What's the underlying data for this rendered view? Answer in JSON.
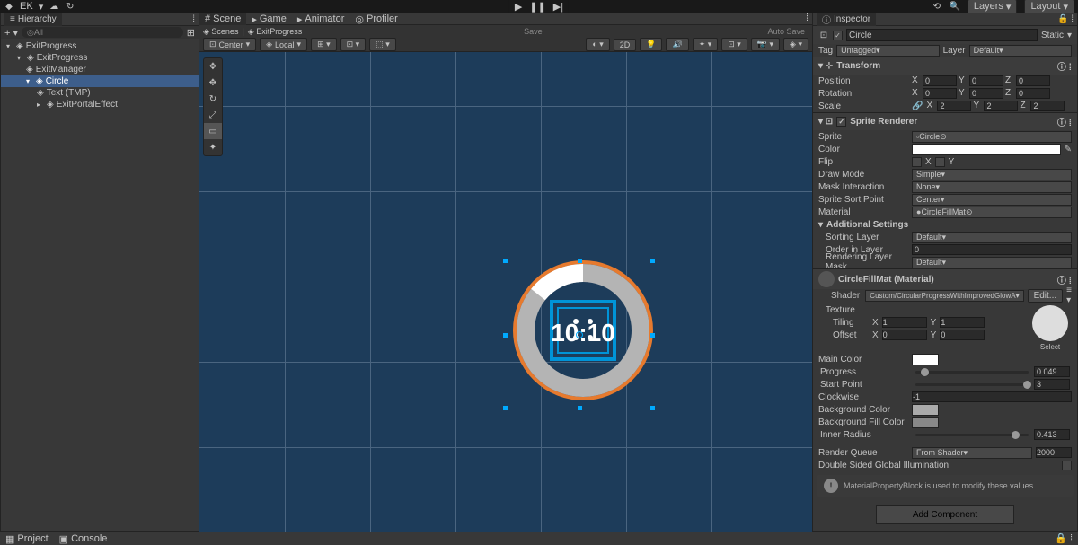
{
  "topbar": {
    "user": "EK",
    "layers_label": "Layers",
    "layout_label": "Layout"
  },
  "playback": {
    "play": "▶",
    "pause": "❚❚",
    "step": "▶|"
  },
  "hierarchy": {
    "title": "Hierarchy",
    "search_placeholder": "All",
    "scene_name": "ExitProgress",
    "nodes": {
      "root": "ExitProgress",
      "n1": "ExitManager",
      "n2": "Circle",
      "n3": "Text (TMP)",
      "n4": "ExitPortalEffect"
    }
  },
  "tabs": {
    "scene": "Scene",
    "game": "Game",
    "animator": "Animator",
    "profiler": "Profiler"
  },
  "scene_toolbar": {
    "scenes_label": "Scenes",
    "current_scene": "ExitProgress",
    "save": "Save",
    "autosave": "Auto Save",
    "center": "Center",
    "local": "Local",
    "mode2d": "2D"
  },
  "inspector": {
    "title": "Inspector",
    "object_name": "Circle",
    "static_label": "Static",
    "tag_label": "Tag",
    "tag_value": "Untagged",
    "layer_label": "Layer",
    "layer_value": "Default",
    "transform": {
      "title": "Transform",
      "position": {
        "label": "Position",
        "x": "0",
        "y": "0",
        "z": "0"
      },
      "rotation": {
        "label": "Rotation",
        "x": "0",
        "y": "0",
        "z": "0"
      },
      "scale": {
        "label": "Scale",
        "x": "2",
        "y": "2",
        "z": "2"
      }
    },
    "sprite_renderer": {
      "title": "Sprite Renderer",
      "sprite_label": "Sprite",
      "sprite_value": "Circle",
      "color_label": "Color",
      "flip_label": "Flip",
      "flip_x": "X",
      "flip_y": "Y",
      "draw_mode_label": "Draw Mode",
      "draw_mode_value": "Simple",
      "mask_label": "Mask Interaction",
      "mask_value": "None",
      "sort_point_label": "Sprite Sort Point",
      "sort_point_value": "Center",
      "material_label": "Material",
      "material_value": "CircleFillMat",
      "additional_label": "Additional Settings",
      "sorting_layer_label": "Sorting Layer",
      "sorting_layer_value": "Default",
      "order_label": "Order in Layer",
      "order_value": "0",
      "render_mask_label": "Rendering Layer Mask",
      "render_mask_value": "Default"
    },
    "material": {
      "title": "CircleFillMat (Material)",
      "shader_label": "Shader",
      "shader_value": "Custom/CircularProgressWithImprovedGlowA",
      "edit_btn": "Edit...",
      "texture_label": "Texture",
      "tiling_label": "Tiling",
      "tiling_x": "1",
      "tiling_y": "1",
      "offset_label": "Offset",
      "offset_x": "0",
      "offset_y": "0",
      "select_label": "Select",
      "main_color_label": "Main Color",
      "progress_label": "Progress",
      "progress_value": "0.049",
      "start_point_label": "Start Point",
      "start_point_value": "3",
      "clockwise_label": "Clockwise",
      "clockwise_value": "-1",
      "bg_color_label": "Background Color",
      "bg_fill_label": "Background Fill Color",
      "inner_radius_label": "Inner Radius",
      "inner_radius_value": "0.413",
      "render_queue_label": "Render Queue",
      "render_queue_mode": "From Shader",
      "render_queue_value": "2000",
      "gi_label": "Double Sided Global Illumination",
      "warning": "MaterialPropertyBlock is used to modify these values",
      "add_component": "Add Component"
    }
  },
  "bottom": {
    "project": "Project",
    "console": "Console"
  },
  "scene_text": "10:10",
  "colors": {
    "ring_outer": "#e67a2e",
    "ring_bg": "#b4b4b4",
    "ring_fill": "#ffffff",
    "square": "#0094d8",
    "scene_bg": "#1d3c5a"
  }
}
